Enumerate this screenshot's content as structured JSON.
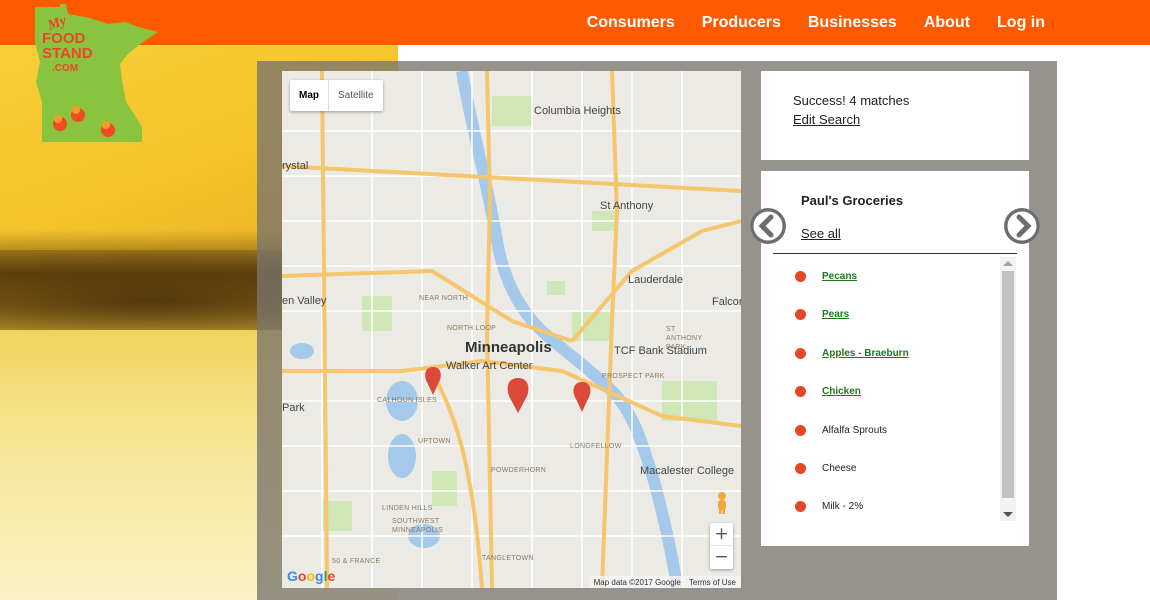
{
  "nav": {
    "items": [
      {
        "label": "Consumers"
      },
      {
        "label": "Producers"
      },
      {
        "label": "Businesses"
      },
      {
        "label": "About"
      },
      {
        "label": "Log in"
      }
    ]
  },
  "logo": {
    "line1": "My",
    "line2": "FOOD",
    "line3": "STAND",
    "line4": ".COM"
  },
  "map": {
    "type_buttons": {
      "map": "Map",
      "satellite": "Satellite"
    },
    "zoom_in": "+",
    "zoom_out": "−",
    "footer": {
      "data": "Map data ©2017 Google",
      "terms": "Terms of Use"
    },
    "brand": "Google",
    "labels": {
      "city": "Minneapolis",
      "columbia_heights": "Columbia Heights",
      "st_anthony": "St Anthony",
      "lauderdale": "Lauderdale",
      "falcon": "Falcon",
      "valley": "en Valley",
      "crystal": "rystal",
      "park": "Park",
      "walker": "Walker Art Center",
      "tcf": "TCF Bank Stadium",
      "macalester": "Macalester College",
      "near_north": "NEAR NORTH",
      "north_loop": "NORTH LOOP",
      "calhoun": "CALHOUN ISLES",
      "uptown": "UPTOWN",
      "powderhorn": "POWDERHORN",
      "longfellow": "LONGFELLOW",
      "linden": "LINDEN HILLS",
      "southwest": "SOUTHWEST MINNEAPOLIS",
      "tangletown": "TANGLETOWN",
      "francis": "50 & FRANCE",
      "prospect": "PROSPECT PARK",
      "st_anthony_park": "ST ANTHONY PARK"
    },
    "color_accent": "#db4a39"
  },
  "results": {
    "message": "Success! 4 matches",
    "edit_link": "Edit Search"
  },
  "producer": {
    "name": "Paul's Groceries",
    "see_all": "See all",
    "products": [
      {
        "label": "Pecans",
        "linked": true
      },
      {
        "label": "Pears",
        "linked": true
      },
      {
        "label": "Apples - Braeburn",
        "linked": true
      },
      {
        "label": "Chicken",
        "linked": true
      },
      {
        "label": "Alfalfa Sprouts",
        "linked": false
      },
      {
        "label": "Cheese",
        "linked": false
      },
      {
        "label": "Milk - 2%",
        "linked": false
      }
    ]
  },
  "colors": {
    "topbar": "#ff5a00",
    "dot": "#e8462a",
    "link_green": "#1b7a1b"
  }
}
